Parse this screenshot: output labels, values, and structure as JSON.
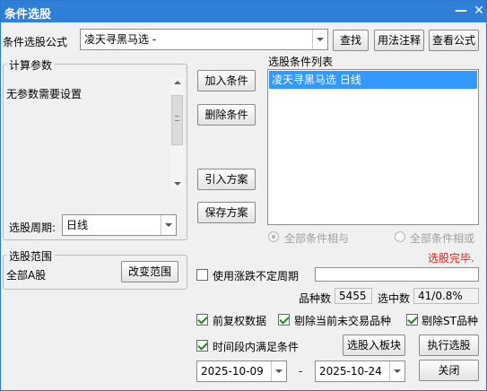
{
  "window": {
    "title": "条件选股"
  },
  "formula": {
    "label": "条件选股公式",
    "value": "凌天寻黑马选  -",
    "find_button": "查找",
    "usage_button": "用法注释",
    "view_button": "查看公式"
  },
  "params": {
    "group_title": "计算参数",
    "text": "无参数需要设置",
    "period_label": "选股周期:",
    "period_value": "日线"
  },
  "actions": {
    "add": "加入条件",
    "delete": "删除条件",
    "import": "引入方案",
    "save": "保存方案"
  },
  "condition_list": {
    "title": "选股条件列表",
    "items": [
      {
        "label": "凌天寻黑马选  日线",
        "selected": true
      }
    ]
  },
  "logic": {
    "and_label": "全部条件相与",
    "or_label": "全部条件相或"
  },
  "status": {
    "text": "选股完毕.",
    "color": "#e8231b"
  },
  "range": {
    "group_title": "选股范围",
    "value": "全部A股",
    "change_button": "改变范围"
  },
  "options": {
    "flex_period_label": "使用涨跌不定周期",
    "flex_period_value": "",
    "count_label": "品种数",
    "count_value": "5455",
    "selected_label": "选中数",
    "selected_value": "41/0.8%",
    "adjust_label": "前复权数据",
    "exclude_untraded_label": "剔除当前未交易品种",
    "exclude_st_label": "剔除ST品种",
    "time_range_label": "时间段内满足条件",
    "start_date": "2025-10-09",
    "date_separator": "-",
    "end_date": "2025-10-24",
    "to_block_button": "选股入板块",
    "run_button": "执行选股",
    "close_button": "关闭"
  },
  "colors": {
    "title_bar": "#2f7fd8",
    "selection": "#3399ff"
  }
}
